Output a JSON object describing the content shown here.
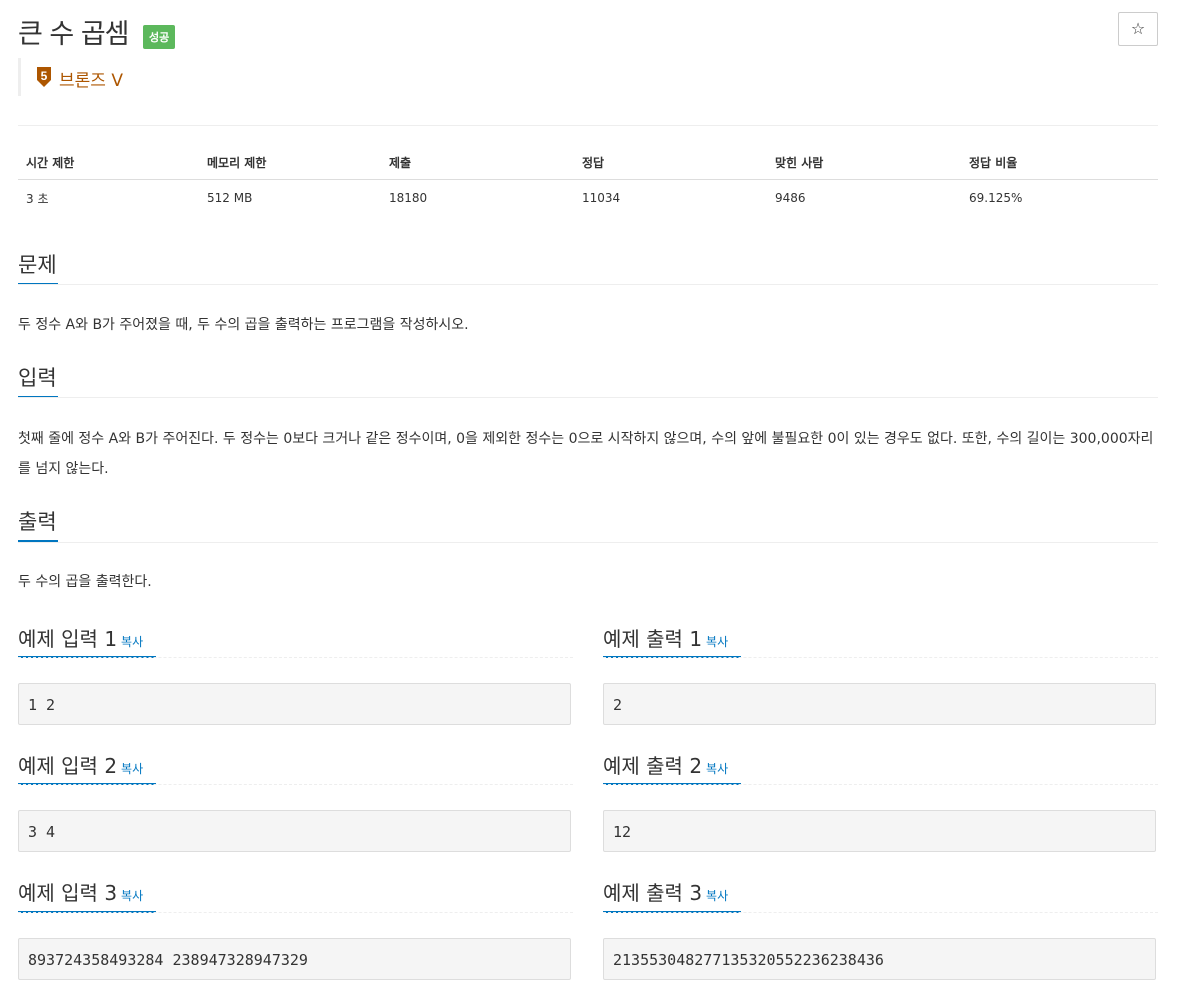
{
  "problem": {
    "title": "큰 수 곱셈",
    "status_badge": "성공",
    "star_icon": "☆",
    "tier_level": "5",
    "tier_name": "브론즈 V",
    "tier_color": "#ad5600"
  },
  "info_table": {
    "headers": [
      "시간 제한",
      "메모리 제한",
      "제출",
      "정답",
      "맞힌 사람",
      "정답 비율"
    ],
    "values": [
      "3 초",
      "512 MB",
      "18180",
      "11034",
      "9486",
      "69.125%"
    ]
  },
  "sections": {
    "problem_title": "문제",
    "problem_text": "두 정수 A와 B가 주어졌을 때, 두 수의 곱을 출력하는 프로그램을 작성하시오.",
    "input_title": "입력",
    "input_text": "첫째 줄에 정수 A와 B가 주어진다. 두 정수는 0보다 크거나 같은 정수이며, 0을 제외한 정수는 0으로 시작하지 않으며, 수의 앞에 불필요한 0이 있는 경우도 없다. 또한, 수의 길이는 300,000자리를 넘지 않는다.",
    "output_title": "출력",
    "output_text": "두 수의 곱을 출력한다."
  },
  "samples": {
    "copy_label": "복사",
    "inputs": [
      {
        "title": "예제 입력 1",
        "data": "1 2"
      },
      {
        "title": "예제 입력 2",
        "data": "3 4"
      },
      {
        "title": "예제 입력 3",
        "data": "893724358493284 238947328947329"
      }
    ],
    "outputs": [
      {
        "title": "예제 출력 1",
        "data": "2"
      },
      {
        "title": "예제 출력 2",
        "data": "12"
      },
      {
        "title": "예제 출력 3",
        "data": "213553048277135320552236238436"
      }
    ]
  }
}
